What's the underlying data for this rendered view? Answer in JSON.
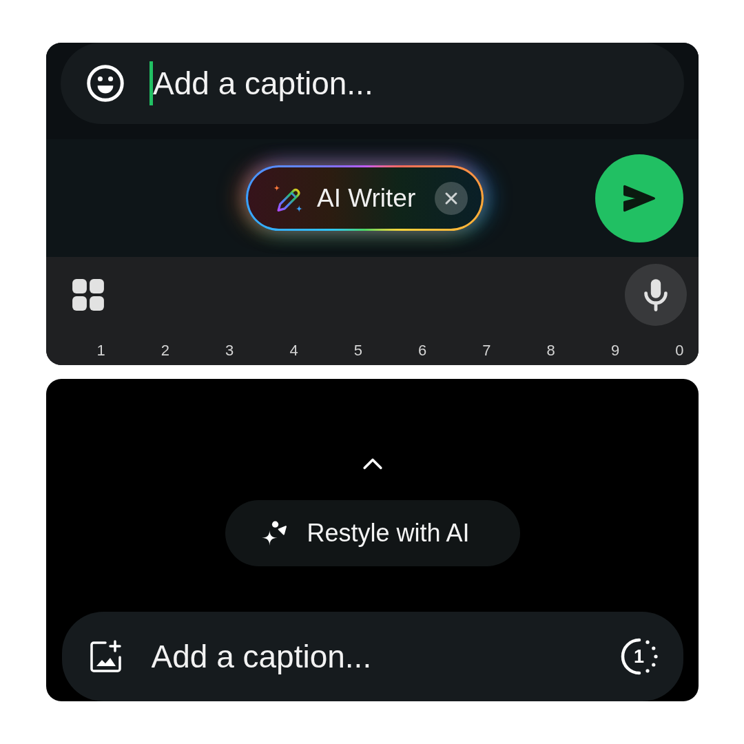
{
  "top_panel": {
    "caption_field": {
      "placeholder": "Add a caption...",
      "focused": true
    },
    "ai_writer_chip": {
      "label": "AI Writer"
    },
    "keyboard": {
      "number_keys": [
        "1",
        "2",
        "3",
        "4",
        "5",
        "6",
        "7",
        "8",
        "9",
        "0"
      ]
    }
  },
  "bottom_panel": {
    "restyle_button": {
      "label": "Restyle with AI"
    },
    "caption_field": {
      "placeholder": "Add a caption..."
    },
    "view_once_button": {
      "label": "1"
    }
  }
}
